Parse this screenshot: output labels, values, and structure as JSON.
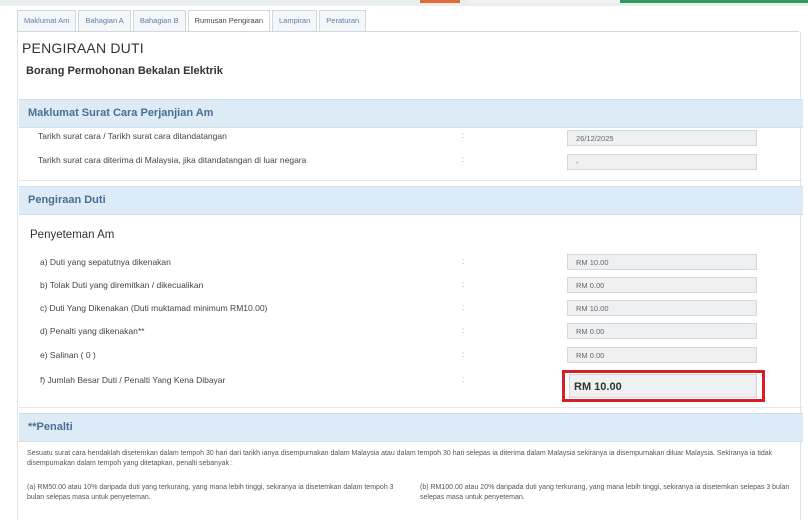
{
  "tabs": [
    {
      "label": "Maklumat Am"
    },
    {
      "label": "Bahagian A"
    },
    {
      "label": "Bahagian B"
    },
    {
      "label": "Rumusan Pengiraan"
    },
    {
      "label": "Lampiran"
    },
    {
      "label": "Peraturan"
    }
  ],
  "page_title": "PENGIRAAN DUTI",
  "form_title": "Borang Permohonan Bekalan Elektrik",
  "section1": {
    "title": "Maklumat Surat Cara Perjanjian Am",
    "rows": [
      {
        "label": "Tarikh surat cara / Tarikh surat cara ditandatangan",
        "value": "26/12/2025"
      },
      {
        "label": "Tarikh surat cara diterima di Malaysia, jika ditandatangan di luar negara",
        "value": "-"
      }
    ]
  },
  "section2": {
    "title": "Pengiraan Duti",
    "subtitle": "Penyeteman Am",
    "rows": [
      {
        "label": "a) Duti yang sepatutnya dikenakan",
        "value": "RM 10.00"
      },
      {
        "label": "b) Tolak Duti yang diremitkan / dikecualikan",
        "value": "RM 0.00"
      },
      {
        "label": "c) Duti Yang Dikenakan (Duti muktamad minimum RM10.00)",
        "value": "RM 10.00"
      },
      {
        "label": "d) Penalti yang dikenakan**",
        "value": "RM 0.00"
      },
      {
        "label": "e) Salinan (  0  )",
        "value": "RM 0.00"
      }
    ],
    "total_label": "f) Jumlah Besar Duti / Penalti Yang Kena Dibayar",
    "total_value": "RM 10.00"
  },
  "colon": ":",
  "penalti": {
    "title": "**Penalti",
    "intro": "Sesuatu surat cara hendaklah disetemkan dalam tempoh 30 hari dari tarikh ianya disempurnakan dalam Malaysia atau dalam tempoh 30 hari selepas ia diterima dalam Malaysia sekiranya ia disempurnakan diluar Malaysia. Sekiranya ia tidak disempurnakan dalam tempoh yang ditetapkan, penalti sebanyak :",
    "a": "(a)  RM50.00 atau 10% daripada duti yang terkurang, yang mana lebih tinggi, sekiranya ia disetemkan dalam tempoh 3 bulan selepas masa untuk penyeteman.",
    "b": "(b)  RM100.00 atau 20% daripada duti yang terkurang, yang mana lebih tinggi, sekiranya ia disetemkan selepas 3 bulan selepas masa untuk penyeteman."
  },
  "colors": {
    "accent": "#4a6f94",
    "section_bg": "#dcebf5",
    "highlight": "#d81f26"
  }
}
